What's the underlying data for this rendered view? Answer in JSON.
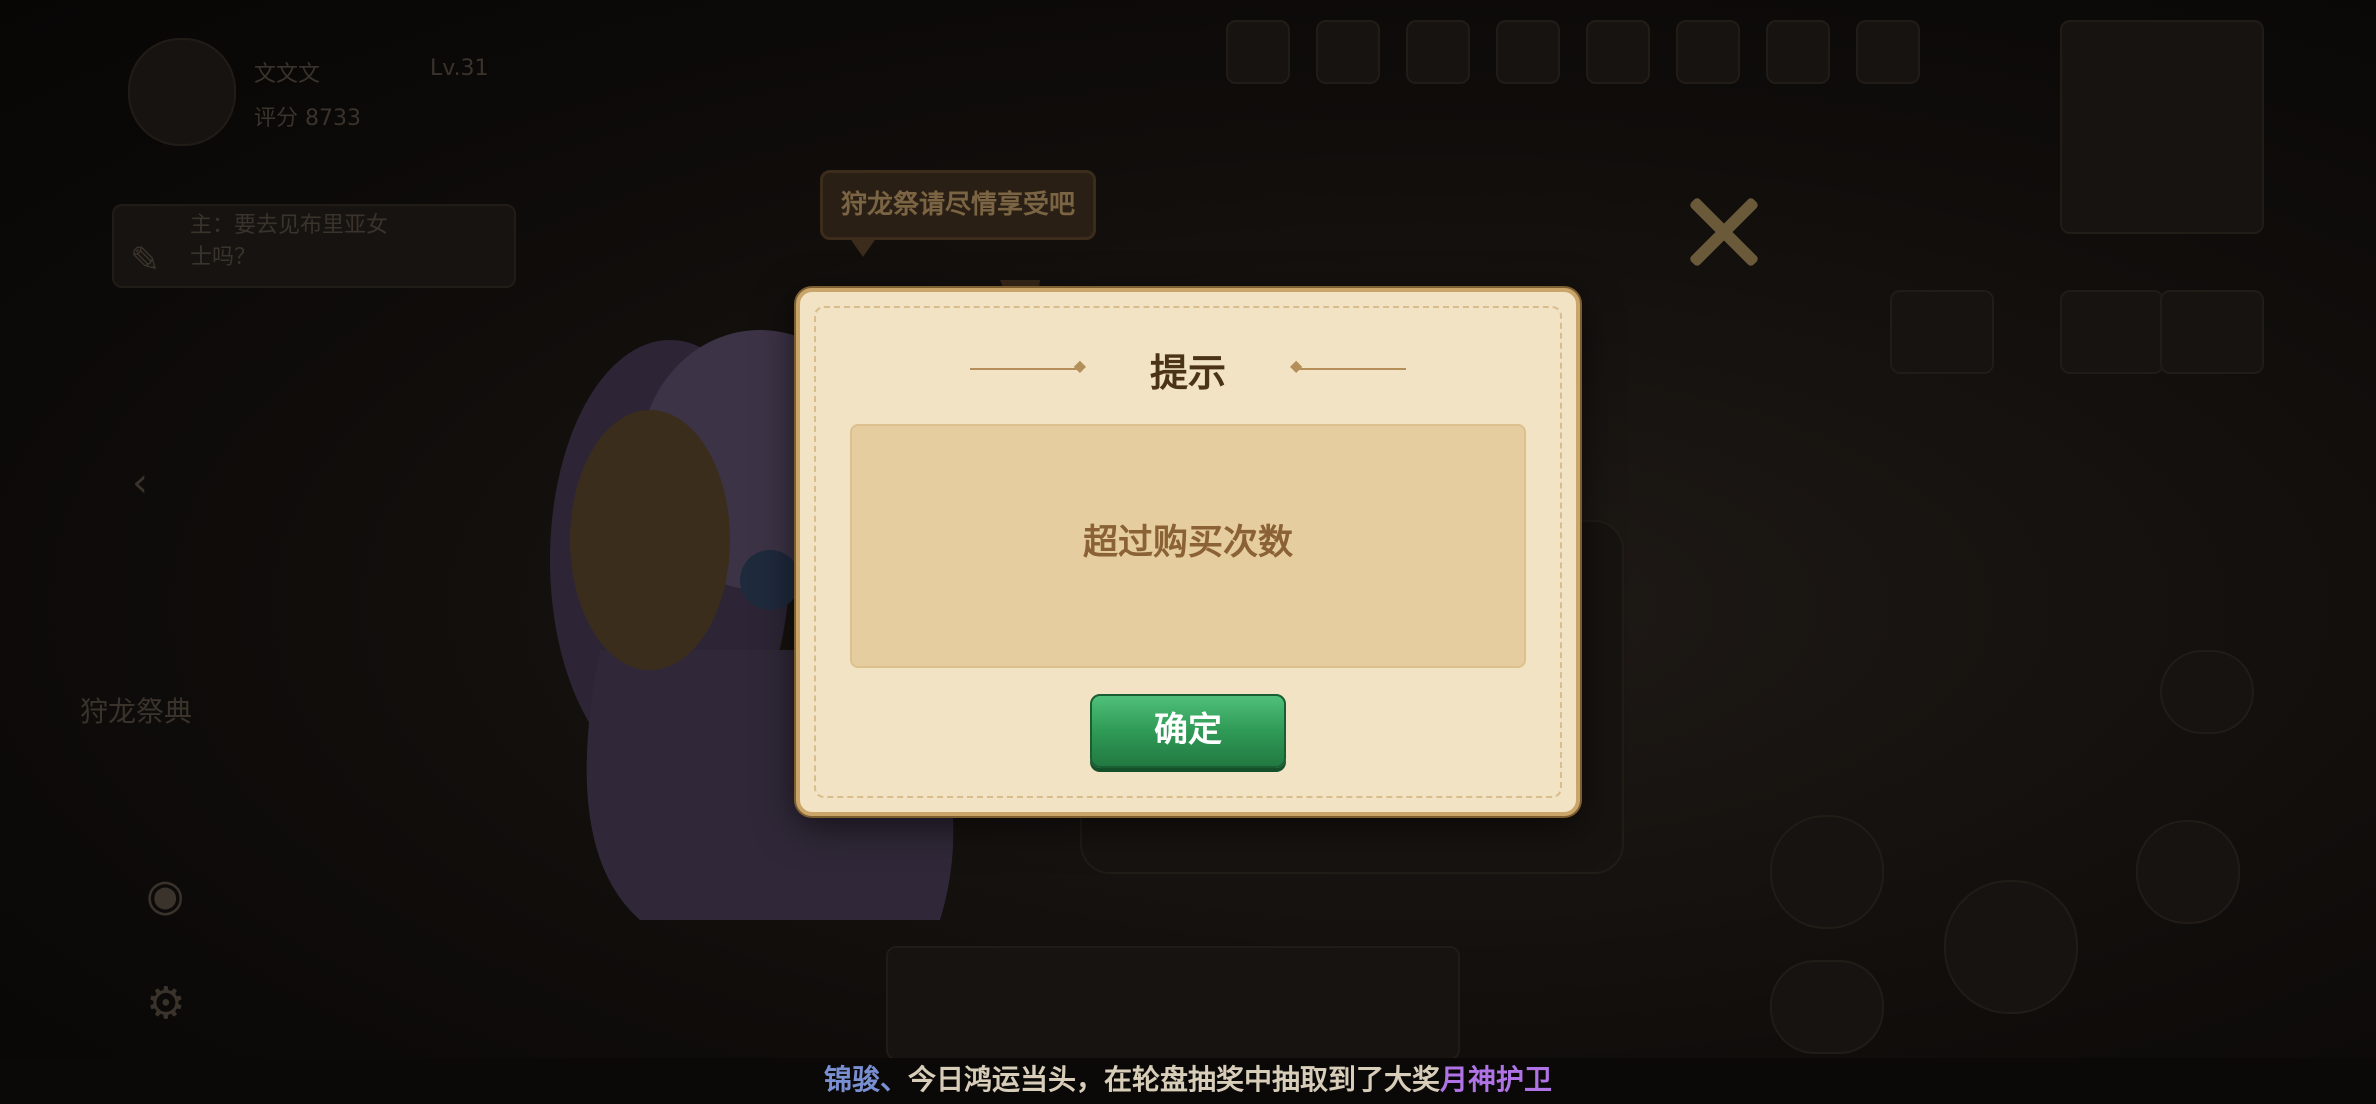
{
  "background": {
    "player": {
      "name": "文文文",
      "level": "Lv.31",
      "score": "评分 8733"
    },
    "quest_text": "主：要去见布里亚女士吗？",
    "event_title": "狩龙祭典",
    "dim_color": "#3a332c"
  },
  "bubble": {
    "text": "狩龙祭请尽情享受吧"
  },
  "dialog": {
    "title": "提示",
    "message": "超过购买次数",
    "confirm_label": "确定",
    "colors": {
      "panel": "#f2e3c4",
      "message_box": "#e6cd9f",
      "button": "#2f9a56"
    }
  },
  "ticker": {
    "player_name": "锦骏",
    "separator": "、",
    "message": "今日鸿运当头，在轮盘抽奖中抽取到了大奖",
    "prize": "月神护卫",
    "colors": {
      "name": "#7a8fd1",
      "prize": "#b073e6"
    }
  },
  "icons": [
    "close-icon",
    "edit-icon",
    "camera-icon",
    "settings-icon",
    "play-icon",
    "chevron-left-icon"
  ]
}
